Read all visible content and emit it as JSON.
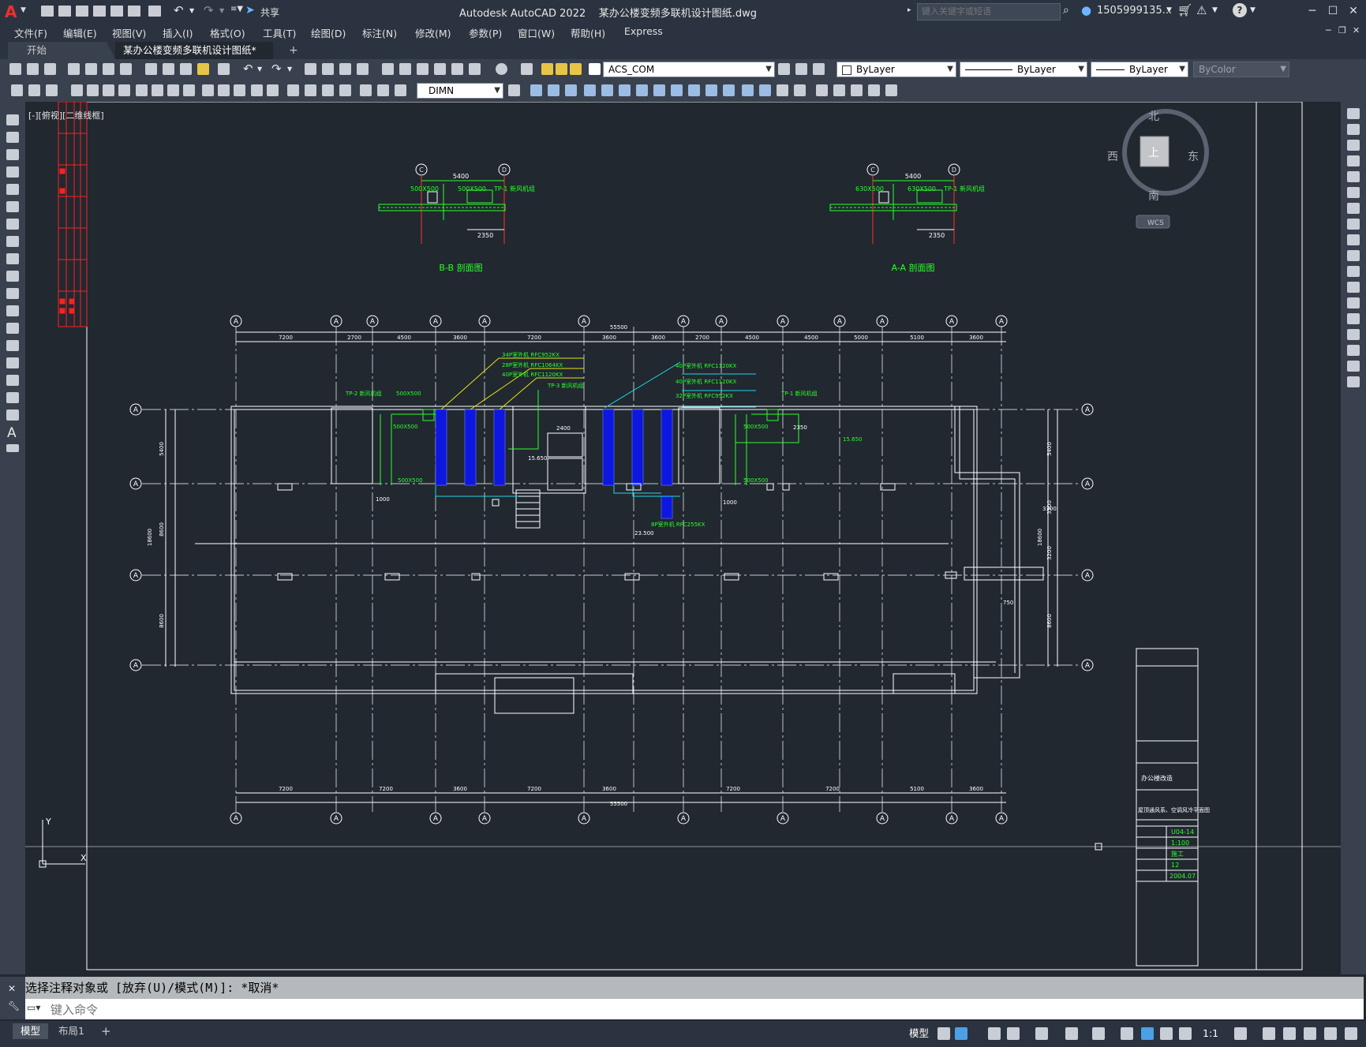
{
  "app": {
    "logo_letter": "A",
    "title": "Autodesk AutoCAD 2022    某办公楼变频多联机设计图纸.dwg",
    "share_label": "共享",
    "search_placeholder": "键入关键字或短语",
    "user": "1505999135...",
    "help_label": "?"
  },
  "menu": [
    "文件(F)",
    "编辑(E)",
    "视图(V)",
    "插入(I)",
    "格式(O)",
    "工具(T)",
    "绘图(D)",
    "标注(N)",
    "修改(M)",
    "参数(P)",
    "窗口(W)",
    "帮助(H)",
    "Express"
  ],
  "tabs": {
    "start": "开始",
    "drawing": "某办公楼变频多联机设计图纸*",
    "close": "×",
    "add": "+"
  },
  "toolbar": {
    "layer": "ACS_COM",
    "color": "ByLayer",
    "linetype": "ByLayer",
    "lineweight": "ByLayer",
    "plotstyle": "ByColor",
    "dimstyle": "DIMN"
  },
  "viewport_label": "[-][俯视][二维线框]",
  "viewcube": {
    "north": "北",
    "south": "南",
    "east": "东",
    "west": "西",
    "top": "上",
    "wcs": "WCS"
  },
  "drawing": {
    "section_bb": {
      "title": "B-B 剖面图",
      "left_axis": "C",
      "right_axis": "D",
      "dim_top": "5400",
      "dim_bottom": "2350",
      "duct1": "500X500",
      "duct2": "500X500",
      "tag": "TP-1 新风机组"
    },
    "section_aa": {
      "title": "A-A 剖面图",
      "left_axis": "C",
      "right_axis": "D",
      "dim_top": "5400",
      "dim_bottom": "2350",
      "duct1": "630X500",
      "duct2": "630X500",
      "tag": "TP-1 新风机组"
    },
    "total_dim": "55500",
    "top_dims": [
      "7200",
      "2700",
      "4500",
      "3600",
      "7200",
      "3600",
      "3600",
      "2700",
      "4500",
      "4500",
      "5000",
      "5100",
      "3600"
    ],
    "bottom_dims": [
      "7200",
      "7200",
      "3600",
      "7200",
      "3600",
      "7200",
      "7200",
      "5100",
      "3600"
    ],
    "side_dims_left": [
      "5400",
      "8600",
      "18600",
      "8600"
    ],
    "side_dims_right": [
      "5400",
      "3300",
      "3200",
      "8600",
      "18600"
    ],
    "axis_label": "A",
    "unit_labels": [
      "34P室外机 RFC952KX",
      "28P室外机 RFC1064KX",
      "40P室外机 RFC1120KX",
      "40P室外机 RFC1120KX",
      "40P室外机 RFC1120KX",
      "32P室外机 RFC952KX",
      "8P室外机 RFC255KX"
    ],
    "tags": [
      "TP-2 新风机组",
      "TP-3 新风机组",
      "TP-1 新风机组"
    ],
    "ducts": [
      "500X500",
      "500X500",
      "500X500",
      "500X500",
      "500X500"
    ],
    "dim_1000": "1000",
    "dim_1000b": "1000",
    "elev": "15.650",
    "elev2": "15.650",
    "elev3": "23.500",
    "dim_2400": "2400",
    "dim_750": "750",
    "dim_2350": "2350",
    "dim_3300": "3300"
  },
  "title_block": {
    "project": "办公楼改造",
    "drawing": "屋顶通风系、空调风冷平面图",
    "drawing_no": "U04-14",
    "scale": "1:100",
    "stage": "施工",
    "sheet_no": "12",
    "date": "2004.07"
  },
  "command": {
    "history": "选择注释对象或 [放弃(U)/模式(M)]: *取消*",
    "placeholder": "键入命令"
  },
  "status": {
    "model_tab": "模型",
    "layout_tab": "布局1",
    "add": "+",
    "model_btn": "模型",
    "scale": "1:1"
  }
}
